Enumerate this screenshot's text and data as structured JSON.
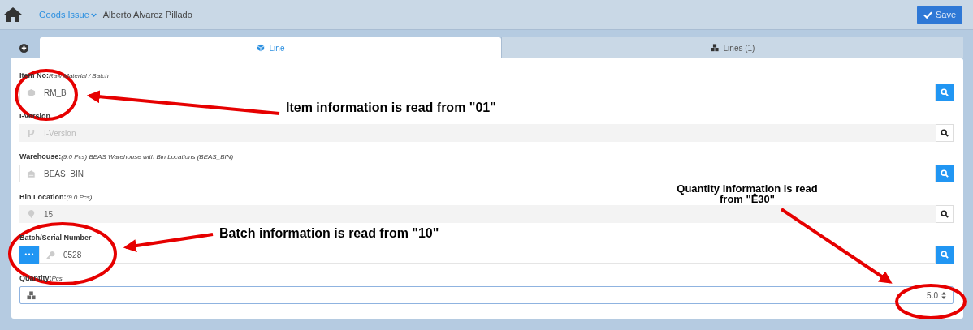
{
  "header": {
    "menu": "Goods Issue",
    "user": "Alberto Alvarez Pillado",
    "save_button": "Save"
  },
  "tabs": [
    {
      "label": "Line",
      "selected": true
    },
    {
      "label": "Lines (1)",
      "selected": false
    }
  ],
  "fields": [
    {
      "label": "Item No:",
      "note": "Raw Material / Batch",
      "kind": "editable",
      "value": "RM_B"
    },
    {
      "label": "I-Version",
      "kind": "readonly",
      "placeholder": "I-Version"
    },
    {
      "label": "Warehouse:",
      "note": "(9.0 Pcs) BEAS Warehouse with Bin Locations (BEAS_BIN)",
      "kind": "editable",
      "value": "BEAS_BIN"
    },
    {
      "label": "Bin Location:",
      "note": "(9.0 Pcs)",
      "kind": "readonly",
      "value": "15"
    },
    {
      "label": "Batch/Serial Number",
      "kind": "batch",
      "value": "0528",
      "more_button": "•••"
    },
    {
      "label": "Quantity:",
      "note": "Pcs",
      "kind": "number",
      "value": "5.0"
    }
  ],
  "annotations": [
    {
      "text": "Item information is read from \"01\""
    },
    {
      "text": "Quantity information is read\nfrom \"Ê30\""
    },
    {
      "text": "Batch information is read from \"10\""
    }
  ]
}
